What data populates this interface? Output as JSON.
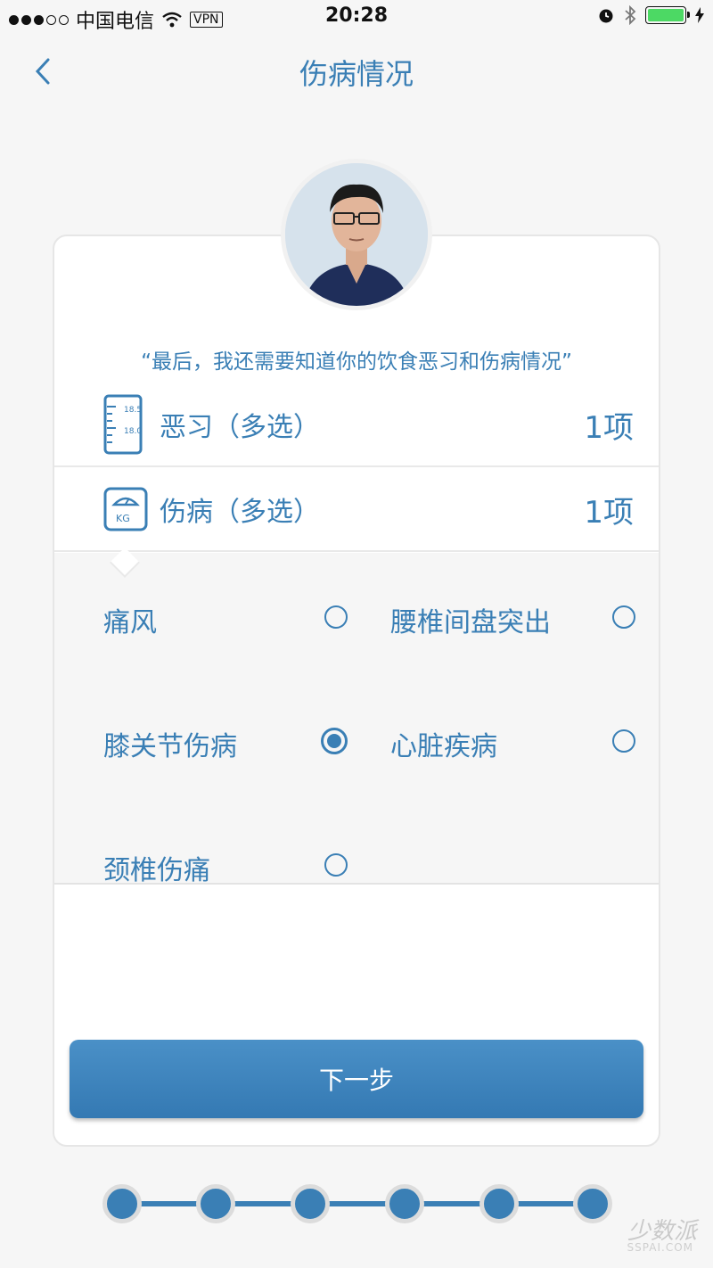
{
  "status_bar": {
    "carrier": "中国电信",
    "vpn": "VPN",
    "time": "20:28",
    "battery_color": "#4cd964"
  },
  "nav": {
    "back_icon": "chevron-left-icon",
    "title": "伤病情况"
  },
  "quote": "“最后，我还需要知道你的饮食恶习和伤病情况”",
  "rows": [
    {
      "icon": "ruler-icon",
      "label": "恶习（多选）",
      "count": "1项"
    },
    {
      "icon": "scale-icon",
      "label": "伤病（多选）",
      "count": "1项",
      "icon_text": "KG"
    }
  ],
  "options": [
    {
      "label": "痛风",
      "checked": false
    },
    {
      "label": "腰椎间盘突出",
      "checked": false
    },
    {
      "label": "膝关节伤病",
      "checked": true
    },
    {
      "label": "心脏疾病",
      "checked": false
    },
    {
      "label": "颈椎伤痛",
      "checked": false
    }
  ],
  "next_button": "下一步",
  "progress": {
    "total_steps": 6,
    "completed_steps": 6
  },
  "accent_color": "#3a7fb5",
  "watermark": {
    "text": "少数派",
    "sub": "SSPAI.COM"
  }
}
